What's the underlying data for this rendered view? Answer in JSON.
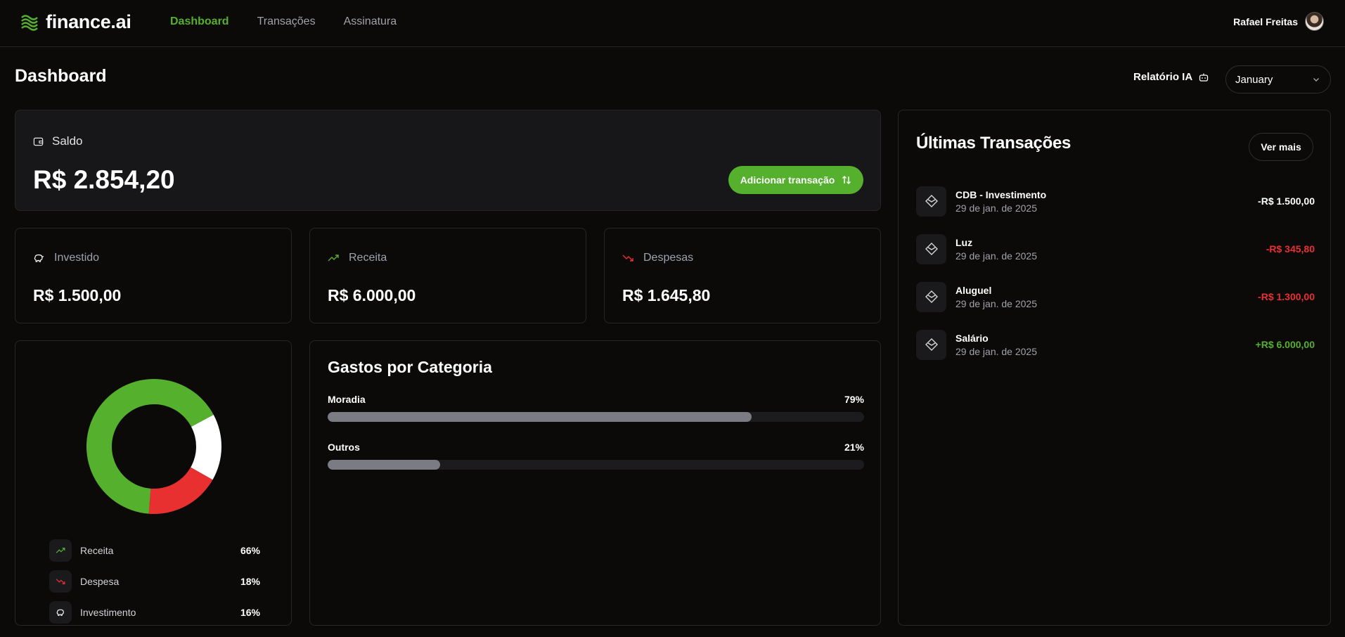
{
  "brand": {
    "name": "finance.ai"
  },
  "nav": {
    "items": [
      "Dashboard",
      "Transações",
      "Assinatura"
    ],
    "active": "Dashboard"
  },
  "user": {
    "name": "Rafael Freitas"
  },
  "page": {
    "title": "Dashboard",
    "report_label": "Relatório IA",
    "month": "January"
  },
  "saldo": {
    "label": "Saldo",
    "value": "R$ 2.854,20",
    "add_button": "Adicionar transação"
  },
  "stats": [
    {
      "label": "Investido",
      "value": "R$ 1.500,00",
      "icon": "piggy-bank-icon"
    },
    {
      "label": "Receita",
      "value": "R$ 6.000,00",
      "icon": "trending-up-icon"
    },
    {
      "label": "Despesas",
      "value": "R$ 1.645,80",
      "icon": "trending-down-icon"
    }
  ],
  "distribution": {
    "items": [
      {
        "label": "Receita",
        "pct": "66%",
        "value": 66,
        "color": "#55b02e"
      },
      {
        "label": "Despesa",
        "pct": "18%",
        "value": 18,
        "color": "#e93030"
      },
      {
        "label": "Investimento",
        "pct": "16%",
        "value": 16,
        "color": "#ffffff"
      }
    ]
  },
  "categories": {
    "title": "Gastos por Categoria",
    "items": [
      {
        "name": "Moradia",
        "pct": "79%",
        "value": 79
      },
      {
        "name": "Outros",
        "pct": "21%",
        "value": 21
      }
    ]
  },
  "transactions": {
    "title": "Últimas Transações",
    "more_label": "Ver mais",
    "items": [
      {
        "name": "CDB - Investimento",
        "date": "29 de jan. de 2025",
        "amount": "-R$ 1.500,00",
        "color": "#ffffff"
      },
      {
        "name": "Luz",
        "date": "29 de jan. de 2025",
        "amount": "-R$ 345,80",
        "color": "#e93030"
      },
      {
        "name": "Aluguel",
        "date": "29 de jan. de 2025",
        "amount": "-R$ 1.300,00",
        "color": "#e93030"
      },
      {
        "name": "Salário",
        "date": "29 de jan. de 2025",
        "amount": "+R$ 6.000,00",
        "color": "#55b02e"
      }
    ]
  },
  "colors": {
    "accent": "#55b02e",
    "danger": "#e93030"
  }
}
